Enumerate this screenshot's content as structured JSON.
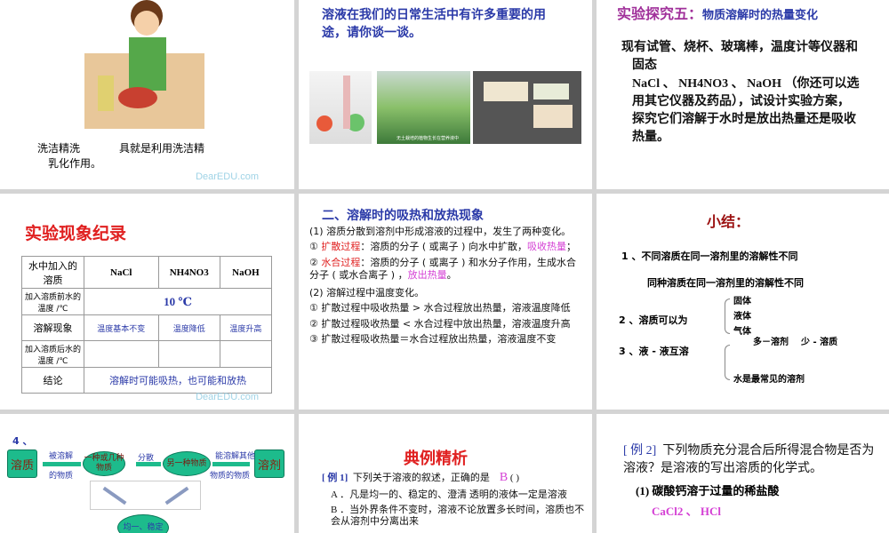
{
  "s1": {
    "line1a": "洗洁精洗",
    "line1b": "具就是利用洗洁精",
    "line2": "乳化作用。",
    "watermark": "DearEDU.com"
  },
  "s2": {
    "text": "溶液在我们的日常生活中有许多重要的用途，请你谈一谈。",
    "photo_caption": "无土栽培的植物生长在营养液中"
  },
  "s3": {
    "title_a": "实验探究五：",
    "title_b": "物质溶解时的热量变化",
    "p1": "现有试管、烧杯、玻璃棒，温度计等仪器和固态",
    "p2": "NaCl 、 NH4NO3 、 NaOH （你还可以选用其它仪器及药品），试设计实验方案，探究它们溶解于水时是放出热量还是吸收热量。"
  },
  "s4": {
    "title": "实验现象纪录",
    "table": {
      "headers": [
        "水中加入的溶质",
        "NaCl",
        "NH4NO3",
        "NaOH"
      ],
      "row_before": {
        "label": "加入溶质前水的温度 /℃",
        "value": "10 ℃"
      },
      "row_phen": {
        "label": "溶解现象",
        "values": [
          "温度基本不变",
          "温度降低",
          "温度升高"
        ]
      },
      "row_after": {
        "label": "加入溶质后水的温度 /℃"
      },
      "row_concl": {
        "label": "结论",
        "value": "溶解时可能吸热，也可能和放热"
      }
    },
    "watermark": "DearEDU.com"
  },
  "s5": {
    "title": "二、溶解时的吸热和放热现象",
    "p1": "(1) 溶质分散到溶剂中形成溶液的过程中，发生了两种变化。",
    "p2_num": "①",
    "p2_red": "扩散过程",
    "p2_text": "：溶质的分子 ( 或离子 ) 向水中扩散，",
    "p2_mag": "吸收热量",
    "p2_end": "；",
    "p3_num": "②",
    "p3_red": "水合过程",
    "p3_text": "：溶质的分子 ( 或离子 ) 和水分子作用，生成水合分子 ( 或水合离子 ) ，",
    "p3_mag": "放出热量",
    "p3_end": "。",
    "p4": "(2) 溶解过程中温度变化。",
    "p5": "① 扩散过程中吸收热量 > 水合过程放出热量，溶液温度降低",
    "p6": "② 扩散过程吸收热量 < 水合过程中放出热量，溶液温度升高",
    "p7": "③ 扩散过程吸收热量＝水合过程放出热量，溶液温度不变"
  },
  "s6": {
    "title": "小结：",
    "l1": "1 、不同溶质在同一溶剂里的溶解性不同",
    "l2": "同种溶质在同一溶剂里的溶解性不同",
    "l3": "2 、溶质可以为",
    "b1": [
      "固体",
      "液体",
      "气体"
    ],
    "l4": "3 、液 - 液互溶",
    "b2a": "多－溶剂",
    "b2b": "少 - 溶质",
    "b2c": "水是最常见的溶剂"
  },
  "s7": {
    "num": "4 、",
    "solute": "溶质",
    "solvent": "溶剂",
    "lbl1a": "被溶解",
    "lbl1b": "的物质",
    "e1": "一种或几种物质",
    "lbl2": "分散",
    "e2": "另一种物质",
    "lbl3a": "能溶解其他",
    "lbl3b": "物质的物质",
    "e3": "均一、稳定"
  },
  "s8": {
    "title": "典例精析",
    "ex": "[ 例 1]",
    "q": "下列关于溶液的叙述，正确的是",
    "ans": "B",
    "paren": "(   )",
    "A": "A ．凡是均一的、稳定的、澄清 透明的液体一定是溶液",
    "B": "B ．当外界条件不变时，溶液不论放置多长时间，溶质也不会从溶剂中分离出来"
  },
  "s9": {
    "ex": "[ 例 2]",
    "q": "下列物质充分混合后所得混合物是否为溶液？是溶液的写出溶质的化学式。",
    "q1": "(1) 碳酸钙溶于过量的稀盐酸",
    "a1": "CaCl2 、 HCl"
  }
}
